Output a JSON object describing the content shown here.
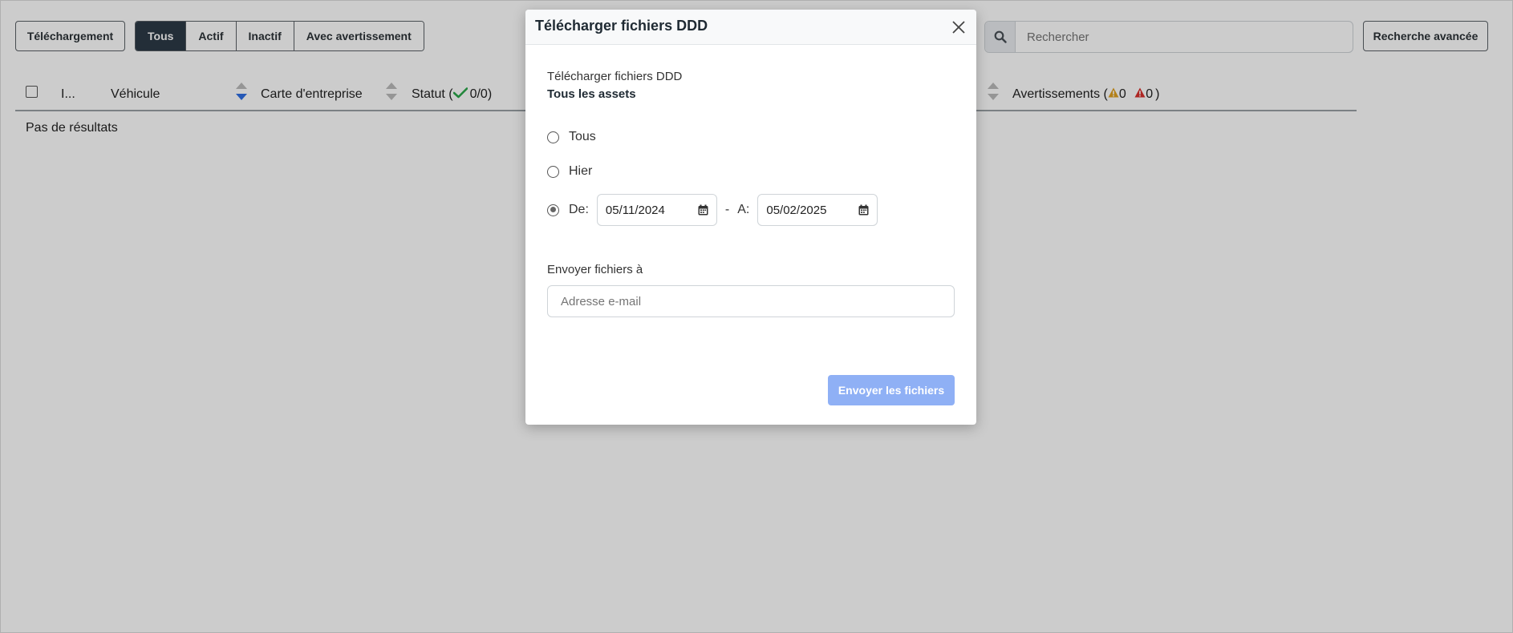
{
  "toolbar": {
    "download_label": "Téléchargement",
    "filters": [
      {
        "label": "Tous",
        "active": true
      },
      {
        "label": "Actif",
        "active": false
      },
      {
        "label": "Inactif",
        "active": false
      },
      {
        "label": "Avec avertissement",
        "active": false
      }
    ],
    "search_placeholder": "Rechercher",
    "advanced_search_label": "Recherche avancée"
  },
  "table": {
    "columns": {
      "id": "I...",
      "vehicle": "Véhicule",
      "company_card": "Carte d'entreprise",
      "status_prefix": "Statut (",
      "status_count": "0/0)",
      "warnings_prefix": "Avertissements (",
      "warnings_count": "0",
      "errors_count": "0",
      "warnings_suffix": ")"
    },
    "empty_text": "Pas de résultats"
  },
  "modal": {
    "title": "Télécharger fichiers DDD",
    "subtitle": "Télécharger fichiers DDD",
    "assets_label": "Tous les assets",
    "options": {
      "all": "Tous",
      "yesterday": "Hier",
      "from_label": "De:",
      "to_label": "A:",
      "separator": "-",
      "selected": "range"
    },
    "from_date": "05/11/2024",
    "to_date": "05/02/2025",
    "email_label": "Envoyer fichiers à",
    "email_placeholder": "Adresse e-mail",
    "submit_label": "Envoyer les fichiers"
  },
  "colors": {
    "active_filter_bg": "#2c3a46",
    "submit_bg": "#8fb0f5",
    "warning_icon": "#e0a020",
    "error_icon": "#d9302c",
    "status_check": "#2aa84a",
    "sort_active": "#2f6fe4"
  }
}
